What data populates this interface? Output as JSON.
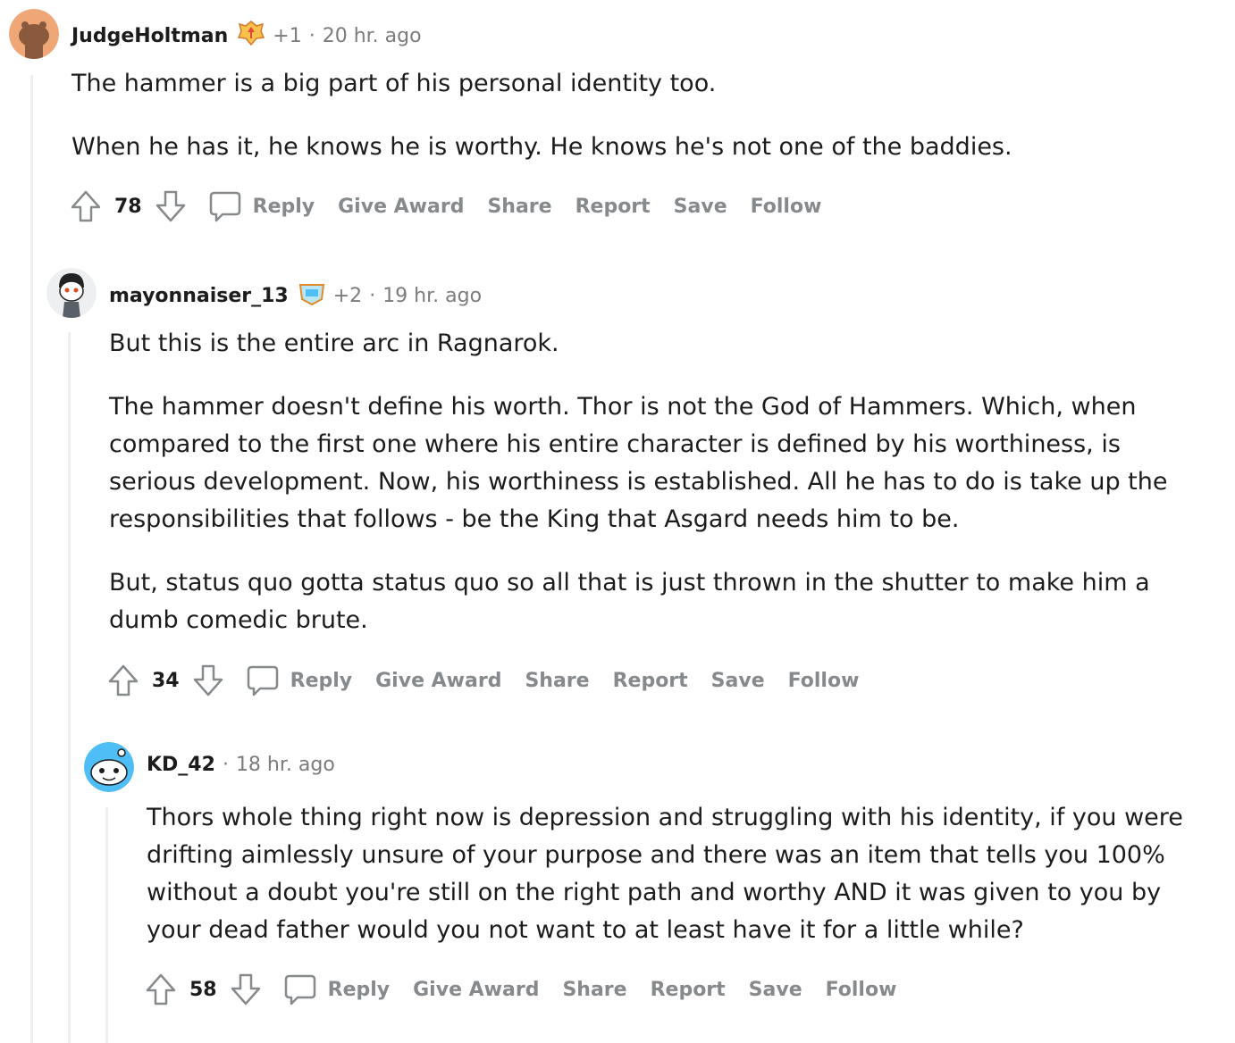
{
  "comments": [
    {
      "username": "JudgeHoltman",
      "flair_count": "+1",
      "time": "20 hr. ago",
      "paragraphs": [
        "The hammer is a big part of his personal identity too.",
        "When he has it, he knows he is worthy. He knows he's not one of the baddies."
      ],
      "score": "78",
      "avatar_bg": "#f0a778"
    },
    {
      "username": "mayonnaiser_13",
      "flair_count": "+2",
      "time": "19 hr. ago",
      "paragraphs": [
        "But this is the entire arc in Ragnarok.",
        "The hammer doesn't define his worth. Thor is not the God of Hammers. Which, when compared to the first one where his entire character is defined by his worthiness, is serious development. Now, his worthiness is established. All he has to do is take up the responsibilities that follows - be the King that Asgard needs him to be.",
        "But, status quo gotta status quo so all that is just thrown in the shutter to make him a dumb comedic brute."
      ],
      "score": "34",
      "avatar_bg": "#edeff1"
    },
    {
      "username": "KD_42",
      "time": "18 hr. ago",
      "paragraphs": [
        "Thors whole thing right now is depression and struggling with his identity, if you were drifting aimlessly unsure of your purpose and there was an item that tells you 100% without a doubt you're still on the right path and worthy AND it was given to you by your dead father would you not want to at least have it for a little while?"
      ],
      "score": "58",
      "avatar_bg": "#4fbdf6"
    }
  ],
  "actions": {
    "reply": "Reply",
    "give_award": "Give Award",
    "share": "Share",
    "report": "Report",
    "save": "Save",
    "follow": "Follow"
  },
  "meta_dot": "·",
  "colors": {
    "muted": "#878a8c",
    "thread_line": "#edeff1",
    "text": "#1c1c1c"
  }
}
